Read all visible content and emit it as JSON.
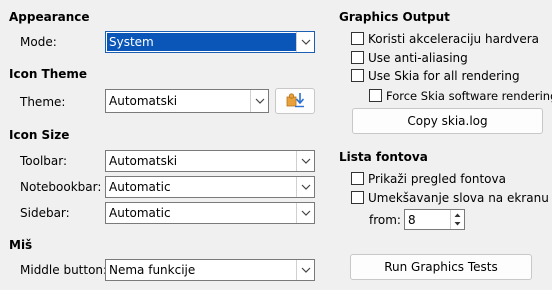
{
  "appearance": {
    "heading": "Appearance",
    "mode_label": "Mode:",
    "mode_value": "System"
  },
  "icon_theme": {
    "heading": "Icon Theme",
    "theme_label": "Theme:",
    "theme_value": "Automatski"
  },
  "icon_size": {
    "heading": "Icon Size",
    "toolbar_label": "Toolbar:",
    "toolbar_value": "Automatski",
    "notebookbar_label": "Notebookbar:",
    "notebookbar_value": "Automatic",
    "sidebar_label": "Sidebar:",
    "sidebar_value": "Automatic"
  },
  "mouse": {
    "heading": "Miš",
    "middle_label": "Middle button:",
    "middle_value": "Nema funkcije"
  },
  "graphics": {
    "heading": "Graphics Output",
    "hw_accel": "Koristi akceleraciju hardvera",
    "antialias": "Use anti-aliasing",
    "skia_all": "Use Skia for all rendering",
    "skia_software": "Force Skia software rendering",
    "copy_skia": "Copy skia.log"
  },
  "fonts": {
    "heading": "Lista fontova",
    "preview": "Prikaži pregled fontova",
    "smoothing": "Umekšavanje slova na ekranu",
    "from_label": "from:",
    "from_value": "8"
  },
  "run_tests": "Run Graphics Tests"
}
